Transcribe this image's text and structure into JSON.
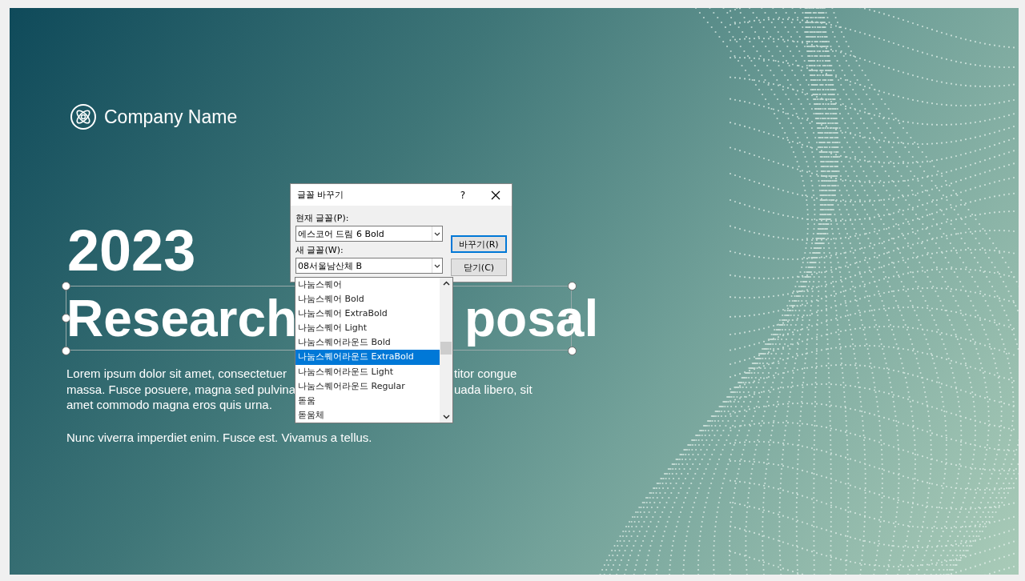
{
  "slide": {
    "company": "Company Name",
    "year": "2023",
    "title_left": "Research",
    "title_right": "posal",
    "title_selected": true,
    "body_lines": [
      {
        "left": "Lorem ipsum dolor sit amet, consectetuer",
        "right": "titor congue"
      },
      {
        "left": "massa. Fusce posuere, magna sed pulvina",
        "right": "uada libero, sit"
      },
      {
        "left": "amet commodo magna eros quis urna."
      }
    ],
    "paragraph_2": "Nunc viverra imperdiet enim. Fusce est. Vivamus a tellus."
  },
  "dialog": {
    "title": "글꼴 바꾸기",
    "help": "?",
    "fields": [
      {
        "label": "현재 글꼴(P):",
        "value": "에스코어 드림 6 Bold"
      },
      {
        "label": "새 글꼴(W):",
        "value": "08서울남산체 B"
      }
    ],
    "buttons": [
      {
        "label": "바꾸기(R)",
        "default": true
      },
      {
        "label": "닫기(C)",
        "default": false
      }
    ],
    "options": [
      {
        "label": "나눔스퀘어",
        "selected": false
      },
      {
        "label": "나눔스퀘어 Bold",
        "selected": false
      },
      {
        "label": "나눔스퀘어 ExtraBold",
        "selected": false
      },
      {
        "label": "나눔스퀘어 Light",
        "selected": false
      },
      {
        "label": "나눔스퀘어라운드 Bold",
        "selected": false
      },
      {
        "label": "나눔스퀘어라운드 ExtraBold",
        "selected": true
      },
      {
        "label": "나눔스퀘어라운드 Light",
        "selected": false
      },
      {
        "label": "나눔스퀘어라운드 Regular",
        "selected": false
      },
      {
        "label": "돋움",
        "selected": false
      },
      {
        "label": "돋움체",
        "selected": false
      }
    ]
  }
}
